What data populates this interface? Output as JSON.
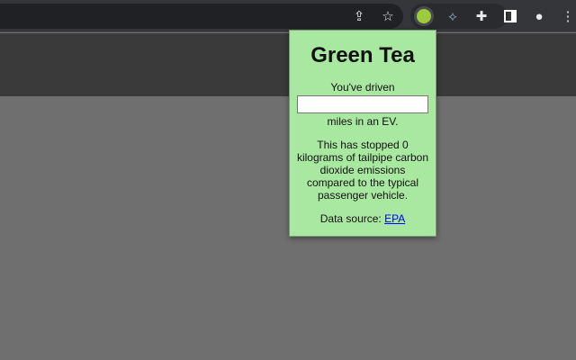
{
  "browser": {
    "icons": [
      "share-icon",
      "bookmark-star-icon",
      "green-tea-extension-icon",
      "extension-icon",
      "puzzle-extensions-icon",
      "side-panel-icon",
      "profile-icon",
      "menu-icon"
    ]
  },
  "popup": {
    "title": "Green Tea",
    "driven_label": "You've driven",
    "miles_value": "",
    "miles_label": "miles in an EV.",
    "summary": "This has stopped 0 kilograms of tailpipe carbon dioxide emissions compared to the typical passenger vehicle.",
    "source_label": "Data source:",
    "source_link": "EPA",
    "background": "#a9e8a0"
  }
}
